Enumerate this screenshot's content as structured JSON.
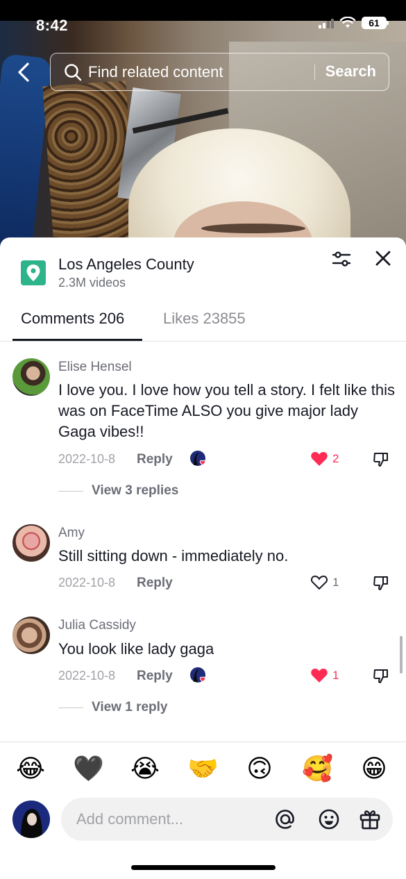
{
  "status_bar": {
    "time": "8:42",
    "battery": "61"
  },
  "search": {
    "placeholder": "Find related content",
    "button": "Search"
  },
  "location": {
    "name": "Los Angeles County",
    "videos": "2.3M videos"
  },
  "tabs": [
    {
      "label": "Comments 206"
    },
    {
      "label": "Likes 23855"
    }
  ],
  "comments": [
    {
      "user": "Elise Hensel",
      "text": "I love you. I love how you tell a story. I felt like this was on FaceTime ALSO you give major lady Gaga vibes!!",
      "date": "2022-10-8",
      "reply": "Reply",
      "likes": "2",
      "liked": true,
      "view_replies": "View 3 replies"
    },
    {
      "user": "Amy",
      "text": "Still sitting down - immediately no.",
      "date": "2022-10-8",
      "reply": "Reply",
      "likes": "1",
      "liked": false
    },
    {
      "user": "Julia Cassidy",
      "text": "You look like lady gaga",
      "date": "2022-10-8",
      "reply": "Reply",
      "likes": "1",
      "liked": true,
      "view_replies": "View 1 reply"
    }
  ],
  "emoji_bar": [
    "😂",
    "🖤",
    "😭",
    "🤝",
    "🙃",
    "🥰",
    "😁"
  ],
  "input": {
    "placeholder": "Add comment..."
  },
  "colors": {
    "like_red": "#fe2c55",
    "location_green": "#2db48a"
  }
}
